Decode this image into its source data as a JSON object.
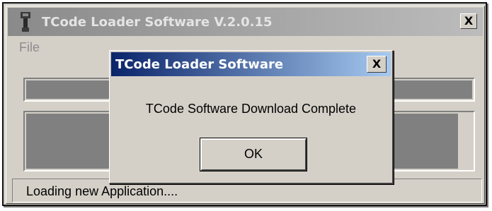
{
  "main_window": {
    "title": "TCode Loader Software V.2.0.15",
    "close_label": "X",
    "app_icon": "device-icon",
    "menu": {
      "file_label": "File"
    },
    "progress": {
      "fraction": 1.0
    },
    "status_text": "Loading new Application...."
  },
  "dialog": {
    "title": "TCode Loader Software",
    "close_label": "X",
    "message": "TCode Software Download Complete",
    "ok_label": "OK"
  },
  "colors": {
    "dialog_titlebar_start": "#0a246a",
    "dialog_titlebar_end": "#a6caf0",
    "inactive_titlebar": "#8a8a8a",
    "window_face": "#d4d0c8"
  }
}
